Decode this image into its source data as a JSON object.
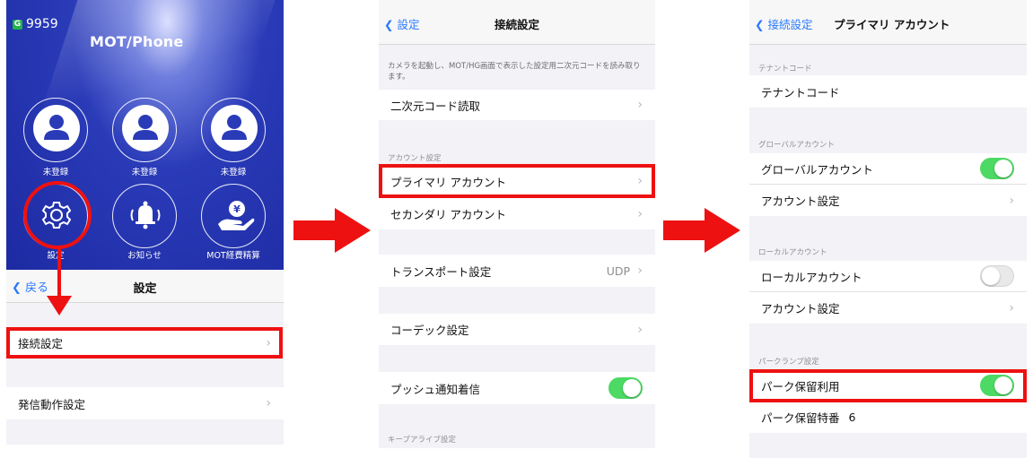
{
  "screen1": {
    "number": "9959",
    "logo": "MOT/Phone",
    "buttons": [
      {
        "label": "未登録",
        "icon": "user-icon"
      },
      {
        "label": "未登録",
        "icon": "user-icon"
      },
      {
        "label": "未登録",
        "icon": "user-icon"
      },
      {
        "label": "設定",
        "icon": "gear-icon"
      },
      {
        "label": "お知らせ",
        "icon": "bell-icon"
      },
      {
        "label": "MOT経費精算",
        "icon": "money-hand-icon"
      }
    ],
    "nav": {
      "back": "戻る",
      "title": "設定"
    },
    "rows": [
      {
        "label": "接続設定"
      },
      {
        "label": "発信動作設定"
      }
    ]
  },
  "screen2": {
    "nav": {
      "back": "設定",
      "title": "接続設定"
    },
    "note": "カメラを起動し、MOT/HG画面で表示した設定用二次元コードを読み取ります。",
    "qr_row": "二次元コード読取",
    "account_header": "アカウント設定",
    "primary": "プライマリ アカウント",
    "secondary": "セカンダリ アカウント",
    "transport": {
      "label": "トランスポート設定",
      "value": "UDP"
    },
    "codec": "コーデック設定",
    "push": {
      "label": "プッシュ通知着信",
      "on": true
    },
    "keepalive_header": "キープアライブ設定"
  },
  "screen3": {
    "nav": {
      "back": "接続設定",
      "title": "プライマリ アカウント"
    },
    "tenant_header": "テナントコード",
    "tenant_row": "テナントコード",
    "global_header": "グローバルアカウント",
    "global_row": {
      "label": "グローバルアカウント",
      "on": true
    },
    "global_settings": "アカウント設定",
    "local_header": "ローカルアカウント",
    "local_row": {
      "label": "ローカルアカウント",
      "on": false
    },
    "local_settings": "アカウント設定",
    "park_header": "パークランプ設定",
    "park_use": {
      "label": "パーク保留利用",
      "on": true
    },
    "park_number": {
      "label": "パーク保留特番",
      "value": "6"
    }
  },
  "colors": {
    "highlight": "#ee1111",
    "link": "#2979ff",
    "toggle_on": "#4cd964",
    "header_blue": "#1d2aa2"
  }
}
